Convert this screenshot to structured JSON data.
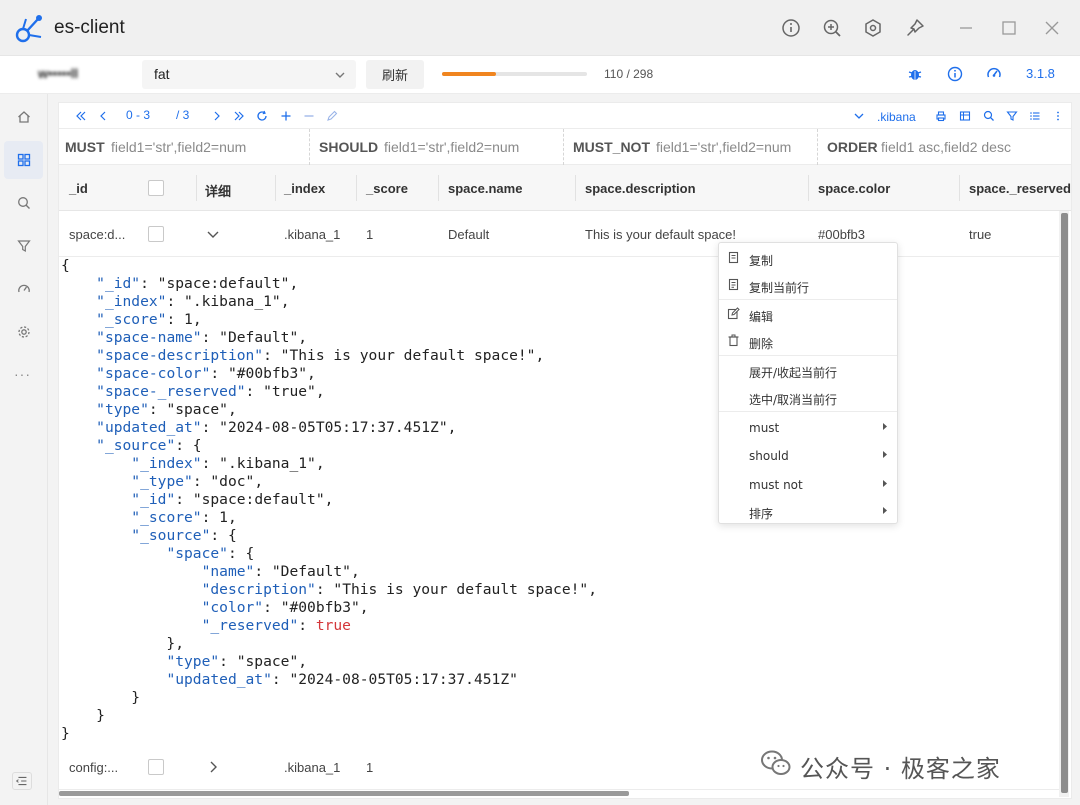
{
  "window": {
    "title": "es-client"
  },
  "toolbar": {
    "connection": "w•••••ll",
    "environment": "fat",
    "refresh_label": "刷新",
    "progress_fraction": 0.37,
    "progress_text": "110 / 298",
    "version": "3.1.8"
  },
  "pager": {
    "range": "0 - 3",
    "total_pages": "/ 3",
    "index": ".kibana"
  },
  "filters": [
    {
      "keyword": "MUST",
      "placeholder": "field1='str',field2=num"
    },
    {
      "keyword": "SHOULD",
      "placeholder": "field1='str',field2=num"
    },
    {
      "keyword": "MUST_NOT",
      "placeholder": "field1='str',field2=num"
    },
    {
      "keyword": "ORDER",
      "placeholder": "field1 asc,field2 desc"
    }
  ],
  "table": {
    "columns": [
      "_id",
      "详细",
      "_index",
      "_score",
      "space.name",
      "space.description",
      "space.color",
      "space._reserved"
    ],
    "rows": [
      {
        "id": "space:d...",
        "index": ".kibana_1",
        "score": "1",
        "name": "Default",
        "description": "This is your default space!",
        "color": "#00bfb3",
        "reserved": "true"
      },
      {
        "id": "config:...",
        "index": ".kibana_1",
        "score": "1",
        "name": "",
        "description": "",
        "color": "",
        "reserved": ""
      }
    ]
  },
  "json_lines": [
    [
      [
        "p",
        "{"
      ]
    ],
    [
      [
        "p",
        "    "
      ],
      [
        "k",
        "\"_id\""
      ],
      [
        "p",
        ": "
      ],
      [
        "s",
        "\"space:default\""
      ],
      [
        "p",
        ","
      ]
    ],
    [
      [
        "p",
        "    "
      ],
      [
        "k",
        "\"_index\""
      ],
      [
        "p",
        ": "
      ],
      [
        "s",
        "\".kibana_1\""
      ],
      [
        "p",
        ","
      ]
    ],
    [
      [
        "p",
        "    "
      ],
      [
        "k",
        "\"_score\""
      ],
      [
        "p",
        ": "
      ],
      [
        "s",
        "1"
      ],
      [
        "p",
        ","
      ]
    ],
    [
      [
        "p",
        "    "
      ],
      [
        "k",
        "\"space-name\""
      ],
      [
        "p",
        ": "
      ],
      [
        "s",
        "\"Default\""
      ],
      [
        "p",
        ","
      ]
    ],
    [
      [
        "p",
        "    "
      ],
      [
        "k",
        "\"space-description\""
      ],
      [
        "p",
        ": "
      ],
      [
        "s",
        "\"This is your default space!\""
      ],
      [
        "p",
        ","
      ]
    ],
    [
      [
        "p",
        "    "
      ],
      [
        "k",
        "\"space-color\""
      ],
      [
        "p",
        ": "
      ],
      [
        "s",
        "\"#00bfb3\""
      ],
      [
        "p",
        ","
      ]
    ],
    [
      [
        "p",
        "    "
      ],
      [
        "k",
        "\"space-_reserved\""
      ],
      [
        "p",
        ": "
      ],
      [
        "s",
        "\"true\""
      ],
      [
        "p",
        ","
      ]
    ],
    [
      [
        "p",
        "    "
      ],
      [
        "k",
        "\"type\""
      ],
      [
        "p",
        ": "
      ],
      [
        "s",
        "\"space\""
      ],
      [
        "p",
        ","
      ]
    ],
    [
      [
        "p",
        "    "
      ],
      [
        "k",
        "\"updated_at\""
      ],
      [
        "p",
        ": "
      ],
      [
        "s",
        "\"2024-08-05T05:17:37.451Z\""
      ],
      [
        "p",
        ","
      ]
    ],
    [
      [
        "p",
        "    "
      ],
      [
        "k",
        "\"_source\""
      ],
      [
        "p",
        ": {"
      ]
    ],
    [
      [
        "p",
        "        "
      ],
      [
        "k",
        "\"_index\""
      ],
      [
        "p",
        ": "
      ],
      [
        "s",
        "\".kibana_1\""
      ],
      [
        "p",
        ","
      ]
    ],
    [
      [
        "p",
        "        "
      ],
      [
        "k",
        "\"_type\""
      ],
      [
        "p",
        ": "
      ],
      [
        "s",
        "\"doc\""
      ],
      [
        "p",
        ","
      ]
    ],
    [
      [
        "p",
        "        "
      ],
      [
        "k",
        "\"_id\""
      ],
      [
        "p",
        ": "
      ],
      [
        "s",
        "\"space:default\""
      ],
      [
        "p",
        ","
      ]
    ],
    [
      [
        "p",
        "        "
      ],
      [
        "k",
        "\"_score\""
      ],
      [
        "p",
        ": "
      ],
      [
        "s",
        "1"
      ],
      [
        "p",
        ","
      ]
    ],
    [
      [
        "p",
        "        "
      ],
      [
        "k",
        "\"_source\""
      ],
      [
        "p",
        ": {"
      ]
    ],
    [
      [
        "p",
        "            "
      ],
      [
        "k",
        "\"space\""
      ],
      [
        "p",
        ": {"
      ]
    ],
    [
      [
        "p",
        "                "
      ],
      [
        "k",
        "\"name\""
      ],
      [
        "p",
        ": "
      ],
      [
        "s",
        "\"Default\""
      ],
      [
        "p",
        ","
      ]
    ],
    [
      [
        "p",
        "                "
      ],
      [
        "k",
        "\"description\""
      ],
      [
        "p",
        ": "
      ],
      [
        "s",
        "\"This is your default space!\""
      ],
      [
        "p",
        ","
      ]
    ],
    [
      [
        "p",
        "                "
      ],
      [
        "k",
        "\"color\""
      ],
      [
        "p",
        ": "
      ],
      [
        "s",
        "\"#00bfb3\""
      ],
      [
        "p",
        ","
      ]
    ],
    [
      [
        "p",
        "                "
      ],
      [
        "k",
        "\"_reserved\""
      ],
      [
        "p",
        ": "
      ],
      [
        "b",
        "true"
      ]
    ],
    [
      [
        "p",
        "            },"
      ]
    ],
    [
      [
        "p",
        "            "
      ],
      [
        "k",
        "\"type\""
      ],
      [
        "p",
        ": "
      ],
      [
        "s",
        "\"space\""
      ],
      [
        "p",
        ","
      ]
    ],
    [
      [
        "p",
        "            "
      ],
      [
        "k",
        "\"updated_at\""
      ],
      [
        "p",
        ": "
      ],
      [
        "s",
        "\"2024-08-05T05:17:37.451Z\""
      ]
    ],
    [
      [
        "p",
        "        }"
      ]
    ],
    [
      [
        "p",
        "    }"
      ]
    ],
    [
      [
        "p",
        "}"
      ]
    ]
  ],
  "context_menu": [
    {
      "label": "复制",
      "icon": "copy-icon"
    },
    {
      "label": "复制当前行",
      "icon": "copy-row-icon"
    },
    {
      "label": "编辑",
      "icon": "edit-icon"
    },
    {
      "label": "删除",
      "icon": "trash-icon"
    },
    {
      "label": "展开/收起当前行"
    },
    {
      "label": "选中/取消当前行"
    },
    {
      "label": "must",
      "submenu": true
    },
    {
      "label": "should",
      "submenu": true
    },
    {
      "label": "must not",
      "submenu": true
    },
    {
      "label": "排序",
      "submenu": true
    }
  ],
  "watermark": {
    "text": "公众号 · 极客之家"
  },
  "colors": {
    "accent": "#1f6feb",
    "progress": "#f0851f",
    "json_key": "#1f5fb8",
    "json_bool": "#d4373a"
  }
}
